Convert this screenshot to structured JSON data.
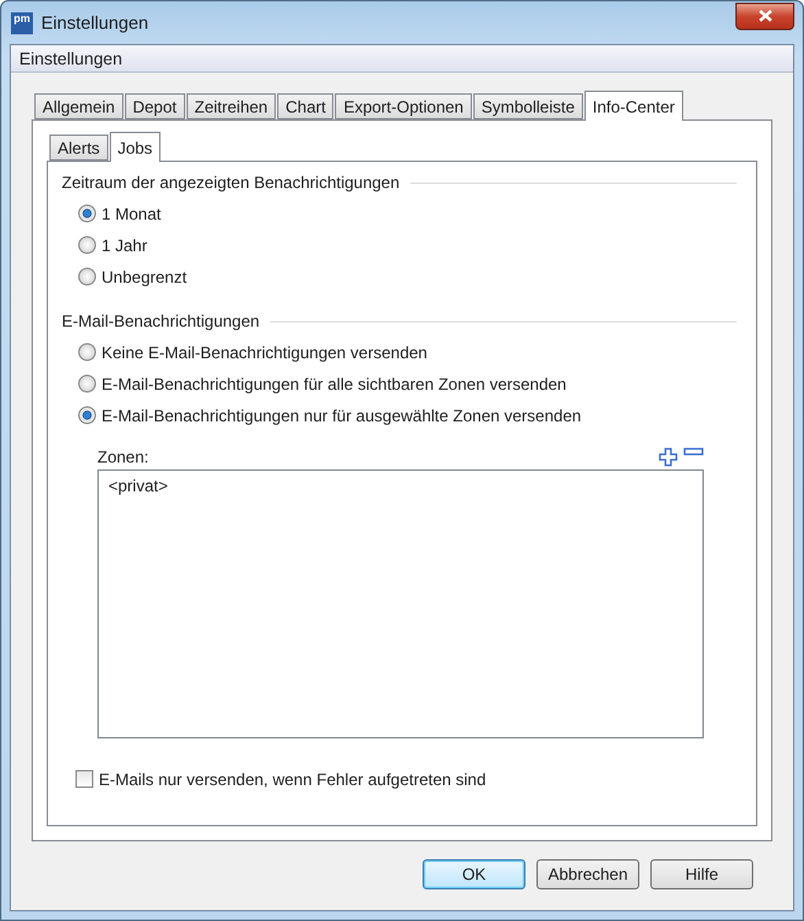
{
  "window": {
    "title": "Einstellungen",
    "logo": "pm"
  },
  "header": "Einstellungen",
  "tabs": [
    {
      "label": "Allgemein",
      "selected": false
    },
    {
      "label": "Depot",
      "selected": false
    },
    {
      "label": "Zeitreihen",
      "selected": false
    },
    {
      "label": "Chart",
      "selected": false
    },
    {
      "label": "Export-Optionen",
      "selected": false
    },
    {
      "label": "Symbolleiste",
      "selected": false
    },
    {
      "label": "Info-Center",
      "selected": true
    }
  ],
  "subtabs": [
    {
      "label": "Alerts",
      "selected": false
    },
    {
      "label": "Jobs",
      "selected": true
    }
  ],
  "period": {
    "title": "Zeitraum der angezeigten Benachrichtigungen",
    "options": [
      {
        "label": "1 Monat",
        "selected": true
      },
      {
        "label": "1 Jahr",
        "selected": false
      },
      {
        "label": "Unbegrenzt",
        "selected": false
      }
    ]
  },
  "email": {
    "title": "E-Mail-Benachrichtigungen",
    "options": [
      {
        "label": "Keine E-Mail-Benachrichtigungen versenden",
        "selected": false
      },
      {
        "label": "E-Mail-Benachrichtigungen für alle sichtbaren Zonen versenden",
        "selected": false
      },
      {
        "label": "E-Mail-Benachrichtigungen nur für ausgewählte Zonen versenden",
        "selected": true
      }
    ]
  },
  "zones": {
    "label": "Zonen:",
    "items": [
      "<privat>"
    ]
  },
  "errors_only": {
    "label": "E-Mails nur versenden, wenn Fehler aufgetreten sind",
    "checked": false
  },
  "buttons": [
    {
      "label": "OK",
      "default": true
    },
    {
      "label": "Abbrechen",
      "default": false
    },
    {
      "label": "Hilfe",
      "default": false
    }
  ]
}
